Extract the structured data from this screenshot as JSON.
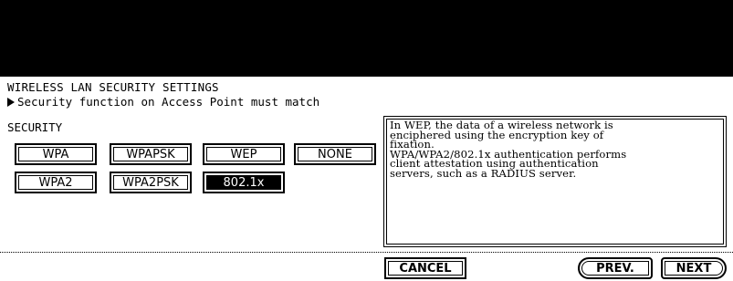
{
  "screen": {
    "title": "WIRELESS LAN SECURITY SETTINGS",
    "subtitle": "Security function on Access Point must match"
  },
  "security": {
    "label": "SECURITY",
    "options": [
      "WPA",
      "WPAPSK",
      "WEP",
      "NONE",
      "WPA2",
      "WPA2PSK",
      "802.1x"
    ],
    "selected": "802.1x"
  },
  "info": {
    "text": "In WEP, the data of a wireless network is\nenciphered using the encryption key of\nfixation.\nWPA/WPA2/802.1x authentication performs\nclient attestation using authentication\nservers, such as a RADIUS server."
  },
  "footer": {
    "cancel_label": "CANCEL",
    "prev_label": "PREV.",
    "next_label": "NEXT"
  },
  "colors": {
    "background": "#ffffff",
    "header_band": "#000000",
    "selected_button_bg": "#000000"
  }
}
